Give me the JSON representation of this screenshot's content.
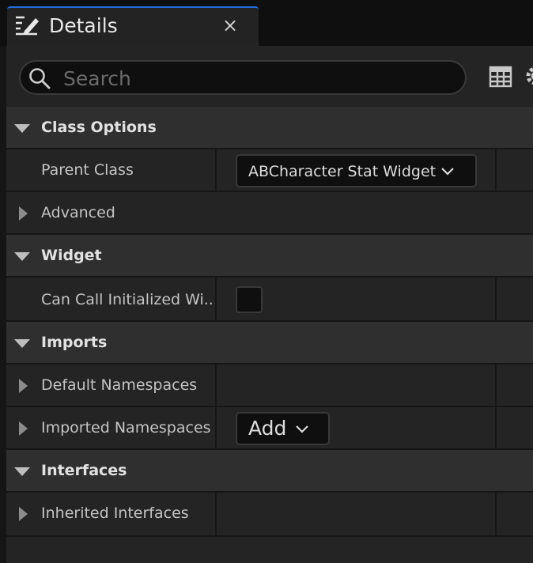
{
  "tab": {
    "title": "Details",
    "close_label": "×"
  },
  "search": {
    "placeholder": "Search"
  },
  "sections": {
    "class_options": {
      "label": "Class Options",
      "parent_class": {
        "label": "Parent Class",
        "value": "ABCharacter Stat Widget"
      },
      "advanced": {
        "label": "Advanced"
      }
    },
    "widget": {
      "label": "Widget",
      "can_call": {
        "label": "Can Call Initialized Wi...",
        "checked": false
      }
    },
    "imports": {
      "label": "Imports",
      "default_namespaces": {
        "label": "Default Namespaces"
      },
      "imported_namespaces": {
        "label": "Imported Namespaces",
        "add_label": "Add"
      }
    },
    "interfaces": {
      "label": "Interfaces",
      "inherited": {
        "label": "Inherited Interfaces"
      }
    }
  },
  "icons": [
    "edit-icon",
    "close-icon",
    "search-icon",
    "table-view-icon",
    "gear-icon",
    "chevron-down-icon",
    "expand-arrow-icon",
    "collapse-arrow-icon"
  ]
}
